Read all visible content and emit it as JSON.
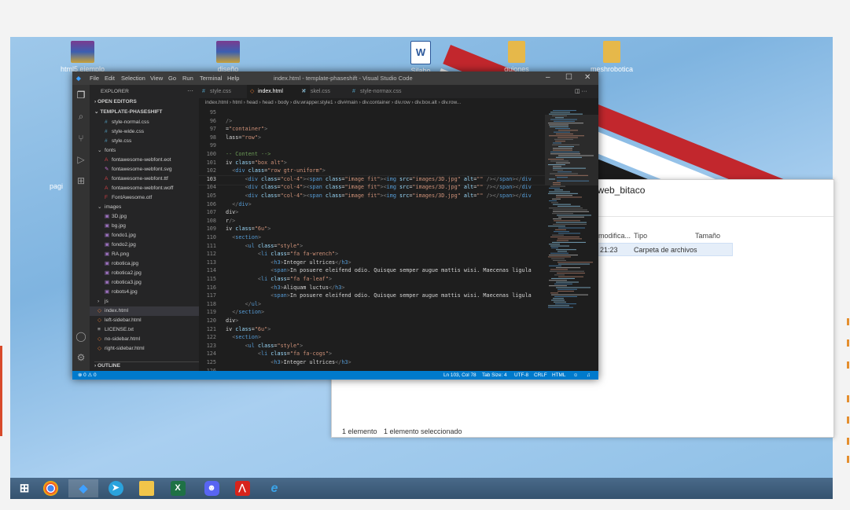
{
  "desktop": {
    "icons": [
      {
        "label": "html5 ejemplo",
        "icon": "winrar-archive-icon"
      },
      {
        "label": "diseño",
        "icon": "winrar-archive-icon"
      },
      {
        "label": "Silabo asignatura",
        "icon": "word-document-icon"
      },
      {
        "label": "guiones",
        "icon": "folder-icon"
      },
      {
        "label": "meshrobotica",
        "icon": "folder-icon"
      },
      {
        "label": "pagi",
        "icon": "folder-icon"
      }
    ]
  },
  "explorer": {
    "title": "paginaweb_bitaco",
    "columns": [
      "modifica...",
      "Tipo",
      "Tamaño"
    ],
    "row": {
      "modified": "21:23",
      "type": "Carpeta de archivos"
    },
    "status_count": "1 elemento",
    "status_selected": "1 elemento seleccionado"
  },
  "vscode": {
    "menu": [
      "File",
      "Edit",
      "Selection",
      "View",
      "Go",
      "Run",
      "Terminal",
      "Help"
    ],
    "window_title": "index.html - template-phaseshift - Visual Studio Code",
    "sidebar": {
      "header": "EXPLORER",
      "open_editors": "OPEN EDITORS",
      "project": "TEMPLATE-PHASESHIFT",
      "files": [
        {
          "name": "style-normal.css",
          "indent": 1,
          "kind": "css"
        },
        {
          "name": "style-wide.css",
          "indent": 1,
          "kind": "css"
        },
        {
          "name": "style.css",
          "indent": 1,
          "kind": "css"
        },
        {
          "name": "fonts",
          "indent": 0,
          "kind": "folder"
        },
        {
          "name": "fontawesome-webfont.eot",
          "indent": 1,
          "kind": "font"
        },
        {
          "name": "fontawesome-webfont.svg",
          "indent": 1,
          "kind": "svg"
        },
        {
          "name": "fontawesome-webfont.ttf",
          "indent": 1,
          "kind": "font"
        },
        {
          "name": "fontawesome-webfont.woff",
          "indent": 1,
          "kind": "font"
        },
        {
          "name": "FontAwesome.otf",
          "indent": 1,
          "kind": "otf"
        },
        {
          "name": "images",
          "indent": 0,
          "kind": "folder"
        },
        {
          "name": "3D.jpg",
          "indent": 1,
          "kind": "img"
        },
        {
          "name": "bg.jpg",
          "indent": 1,
          "kind": "img"
        },
        {
          "name": "fondo1.jpg",
          "indent": 1,
          "kind": "img"
        },
        {
          "name": "fondo2.jpg",
          "indent": 1,
          "kind": "img"
        },
        {
          "name": "RA.png",
          "indent": 1,
          "kind": "img"
        },
        {
          "name": "robotica.jpg",
          "indent": 1,
          "kind": "img"
        },
        {
          "name": "robotica2.jpg",
          "indent": 1,
          "kind": "img"
        },
        {
          "name": "robotica3.jpg",
          "indent": 1,
          "kind": "img"
        },
        {
          "name": "robots4.jpg",
          "indent": 1,
          "kind": "img"
        },
        {
          "name": "js",
          "indent": 0,
          "kind": "folder-closed"
        },
        {
          "name": "index.html",
          "indent": 0,
          "kind": "html",
          "selected": true
        },
        {
          "name": "left-sidebar.html",
          "indent": 0,
          "kind": "html"
        },
        {
          "name": "LICENSE.txt",
          "indent": 0,
          "kind": "txt"
        },
        {
          "name": "no-sidebar.html",
          "indent": 0,
          "kind": "html"
        },
        {
          "name": "right-sidebar.html",
          "indent": 0,
          "kind": "html"
        }
      ],
      "outline": "OUTLINE"
    },
    "tabs": [
      {
        "label": "style.css",
        "active": false
      },
      {
        "label": "index.html",
        "active": true
      },
      {
        "label": "skel.css",
        "active": false
      },
      {
        "label": "style-normax.css",
        "active": false
      }
    ],
    "breadcrumbs": "index.html › html › head › head › body › div.wrapper.style1 › div#main › div.container › div.row › div.box.alt › div.row...",
    "code_lines": [
      {
        "n": "95",
        "t": ""
      },
      {
        "n": "96",
        "t": "/>"
      },
      {
        "n": "97",
        "t": "=\"container\">"
      },
      {
        "n": "98",
        "t": "lass=\"row\">"
      },
      {
        "n": "99",
        "t": ""
      },
      {
        "n": "100",
        "t": "-- Content -->"
      },
      {
        "n": "101",
        "t": "iv class=\"box alt\">"
      },
      {
        "n": "102",
        "t": "  <div class=\"row gtr-uniform\">"
      },
      {
        "n": "103",
        "t": "      <div class=\"col-4\"><span class=\"image fit\"><img src=\"images/3D.jpg\" alt=\"\" /></span></div"
      },
      {
        "n": "104",
        "t": "      <div class=\"col-4\"><span class=\"image fit\"><img src=\"images/3D.jpg\" alt=\"\" /></span></div"
      },
      {
        "n": "105",
        "t": "      <div class=\"col-4\"><span class=\"image fit\"><img src=\"images/3D.jpg\" alt=\"\" /></span></div"
      },
      {
        "n": "106",
        "t": "  </div>"
      },
      {
        "n": "107",
        "t": "div>"
      },
      {
        "n": "108",
        "t": "r/>"
      },
      {
        "n": "109",
        "t": "iv class=\"6u\">"
      },
      {
        "n": "110",
        "t": "  <section>"
      },
      {
        "n": "111",
        "t": "      <ul class=\"style\">"
      },
      {
        "n": "112",
        "t": "          <li class=\"fa fa-wrench\">"
      },
      {
        "n": "113",
        "t": "              <h3>Integer ultrices</h3>"
      },
      {
        "n": "114",
        "t": "              <span>In posuere eleifend odio. Quisque semper augue mattis wisi. Maecenas ligula"
      },
      {
        "n": "115",
        "t": "          <li class=\"fa fa-leaf\">"
      },
      {
        "n": "116",
        "t": "              <h3>Aliquam luctus</h3>"
      },
      {
        "n": "117",
        "t": "              <span>In posuere eleifend odio. Quisque semper augue mattis wisi. Maecenas ligula"
      },
      {
        "n": "118",
        "t": "      </ul>"
      },
      {
        "n": "119",
        "t": "  </section>"
      },
      {
        "n": "120",
        "t": "div>"
      },
      {
        "n": "121",
        "t": "iv class=\"6u\">"
      },
      {
        "n": "122",
        "t": "  <section>"
      },
      {
        "n": "123",
        "t": "      <ul class=\"style\">"
      },
      {
        "n": "124",
        "t": "          <li class=\"fa fa-cogs\">"
      },
      {
        "n": "125",
        "t": "              <h3>Integer ultrices</h3>"
      },
      {
        "n": "126",
        "t": ""
      }
    ],
    "current_line": "103",
    "status": {
      "problems": "⊗ 0 ⚠ 0",
      "position": "Ln 103, Col 78",
      "tab_size": "Tab Size: 4",
      "encoding": "UTF-8",
      "eol": "CRLF",
      "language": "HTML"
    }
  },
  "taskbar": {
    "items": [
      "start-button",
      "chrome-icon",
      "vscode-icon",
      "telegram-icon",
      "file-explorer-icon",
      "excel-icon",
      "discord-icon",
      "acrobat-icon",
      "internet-explorer-icon"
    ]
  },
  "colors": {
    "vscode_statusbar": "#007acc",
    "editor_bg": "#1e1e1e",
    "sidebar_bg": "#252526"
  }
}
